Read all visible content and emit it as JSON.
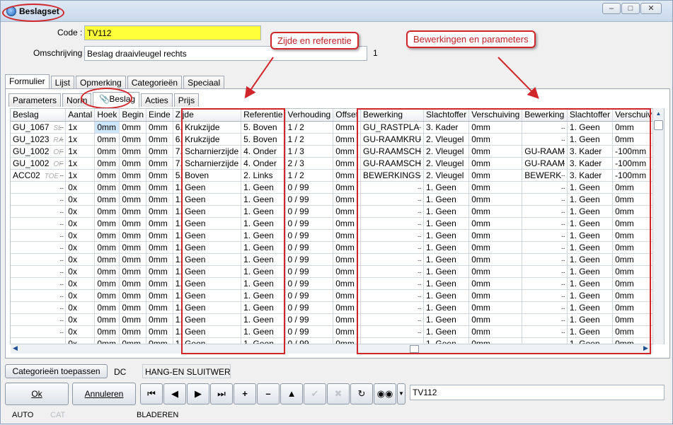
{
  "window": {
    "title": "Beslagset"
  },
  "form": {
    "code_label": "Code :",
    "code_value": "TV112",
    "omschrijving_label": "Omschrijving :",
    "omschrijving_value": "Beslag draaivleugel rechts",
    "count": "1"
  },
  "main_tabs": [
    "Formulier",
    "Lijst",
    "Opmerking",
    "Categorieën",
    "Speciaal"
  ],
  "sub_tabs": [
    "Parameters",
    "Norm",
    "Beslag",
    "Acties",
    "Prijs"
  ],
  "columns": [
    "Beslag",
    "Aantal",
    "Hoek",
    "Begin",
    "Einde",
    "Zijde",
    "Referentie",
    "Verhouding",
    "Offset",
    "Bewerking",
    "Slachtoffer",
    "Verschuiving",
    "Bewerking",
    "Slachtoffer",
    "Verschuiving"
  ],
  "rows": [
    [
      "GU_1067",
      "SL",
      "1x",
      "0mm",
      "0mm",
      "0mm",
      "6. Krukzijde",
      "5. Boven",
      "1 / 2",
      "0mm",
      "GU_RASTPLA",
      "3. Kader",
      "0mm",
      "",
      "1. Geen",
      "0mm"
    ],
    [
      "GU_1023",
      "RA",
      "1x",
      "0mm",
      "0mm",
      "0mm",
      "6. Krukzijde",
      "5. Boven",
      "1 / 2",
      "0mm",
      "GU-RAAMKRU",
      "2. Vleugel",
      "0mm",
      "",
      "1. Geen",
      "0mm"
    ],
    [
      "GU_1002",
      "OF",
      "1x",
      "0mm",
      "0mm",
      "0mm",
      "7. Scharnierzijde",
      "4. Onder",
      "1 / 3",
      "0mm",
      "GU-RAAMSCH",
      "2. Vleugel",
      "0mm",
      "GU-RAAM",
      "3. Kader",
      "-100mm"
    ],
    [
      "GU_1002",
      "OF",
      "1x",
      "0mm",
      "0mm",
      "0mm",
      "7. Scharnierzijde",
      "4. Onder",
      "2 / 3",
      "0mm",
      "GU-RAAMSCH",
      "2. Vleugel",
      "0mm",
      "GU-RAAM",
      "3. Kader",
      "-100mm"
    ],
    [
      "ACC02",
      "TOE",
      "1x",
      "0mm",
      "0mm",
      "0mm",
      "5. Boven",
      "2. Links",
      "1 / 2",
      "0mm",
      "BEWERKINGS",
      "2. Vleugel",
      "0mm",
      "BEWERK",
      "3. Kader",
      "-100mm"
    ]
  ],
  "empty_row": [
    "0x",
    "0mm",
    "0mm",
    "0mm",
    "1. Geen",
    "1. Geen",
    "0 / 99",
    "0mm",
    "",
    "1. Geen",
    "0mm",
    "",
    "1. Geen",
    "0mm"
  ],
  "callouts": {
    "zijde": "Zijde en referentie",
    "bewerking": "Bewerkingen en parameters"
  },
  "bottom": {
    "categorieen_btn": "Categorieën toepassen",
    "dc": "DC",
    "hang": "HANG-EN SLUITWERK",
    "ok": "Ok",
    "annuleren": "Annuleren",
    "search_value": "TV112"
  },
  "status": {
    "auto": "AUTO",
    "cat": "CAT",
    "bladeren": "BLADEREN"
  }
}
